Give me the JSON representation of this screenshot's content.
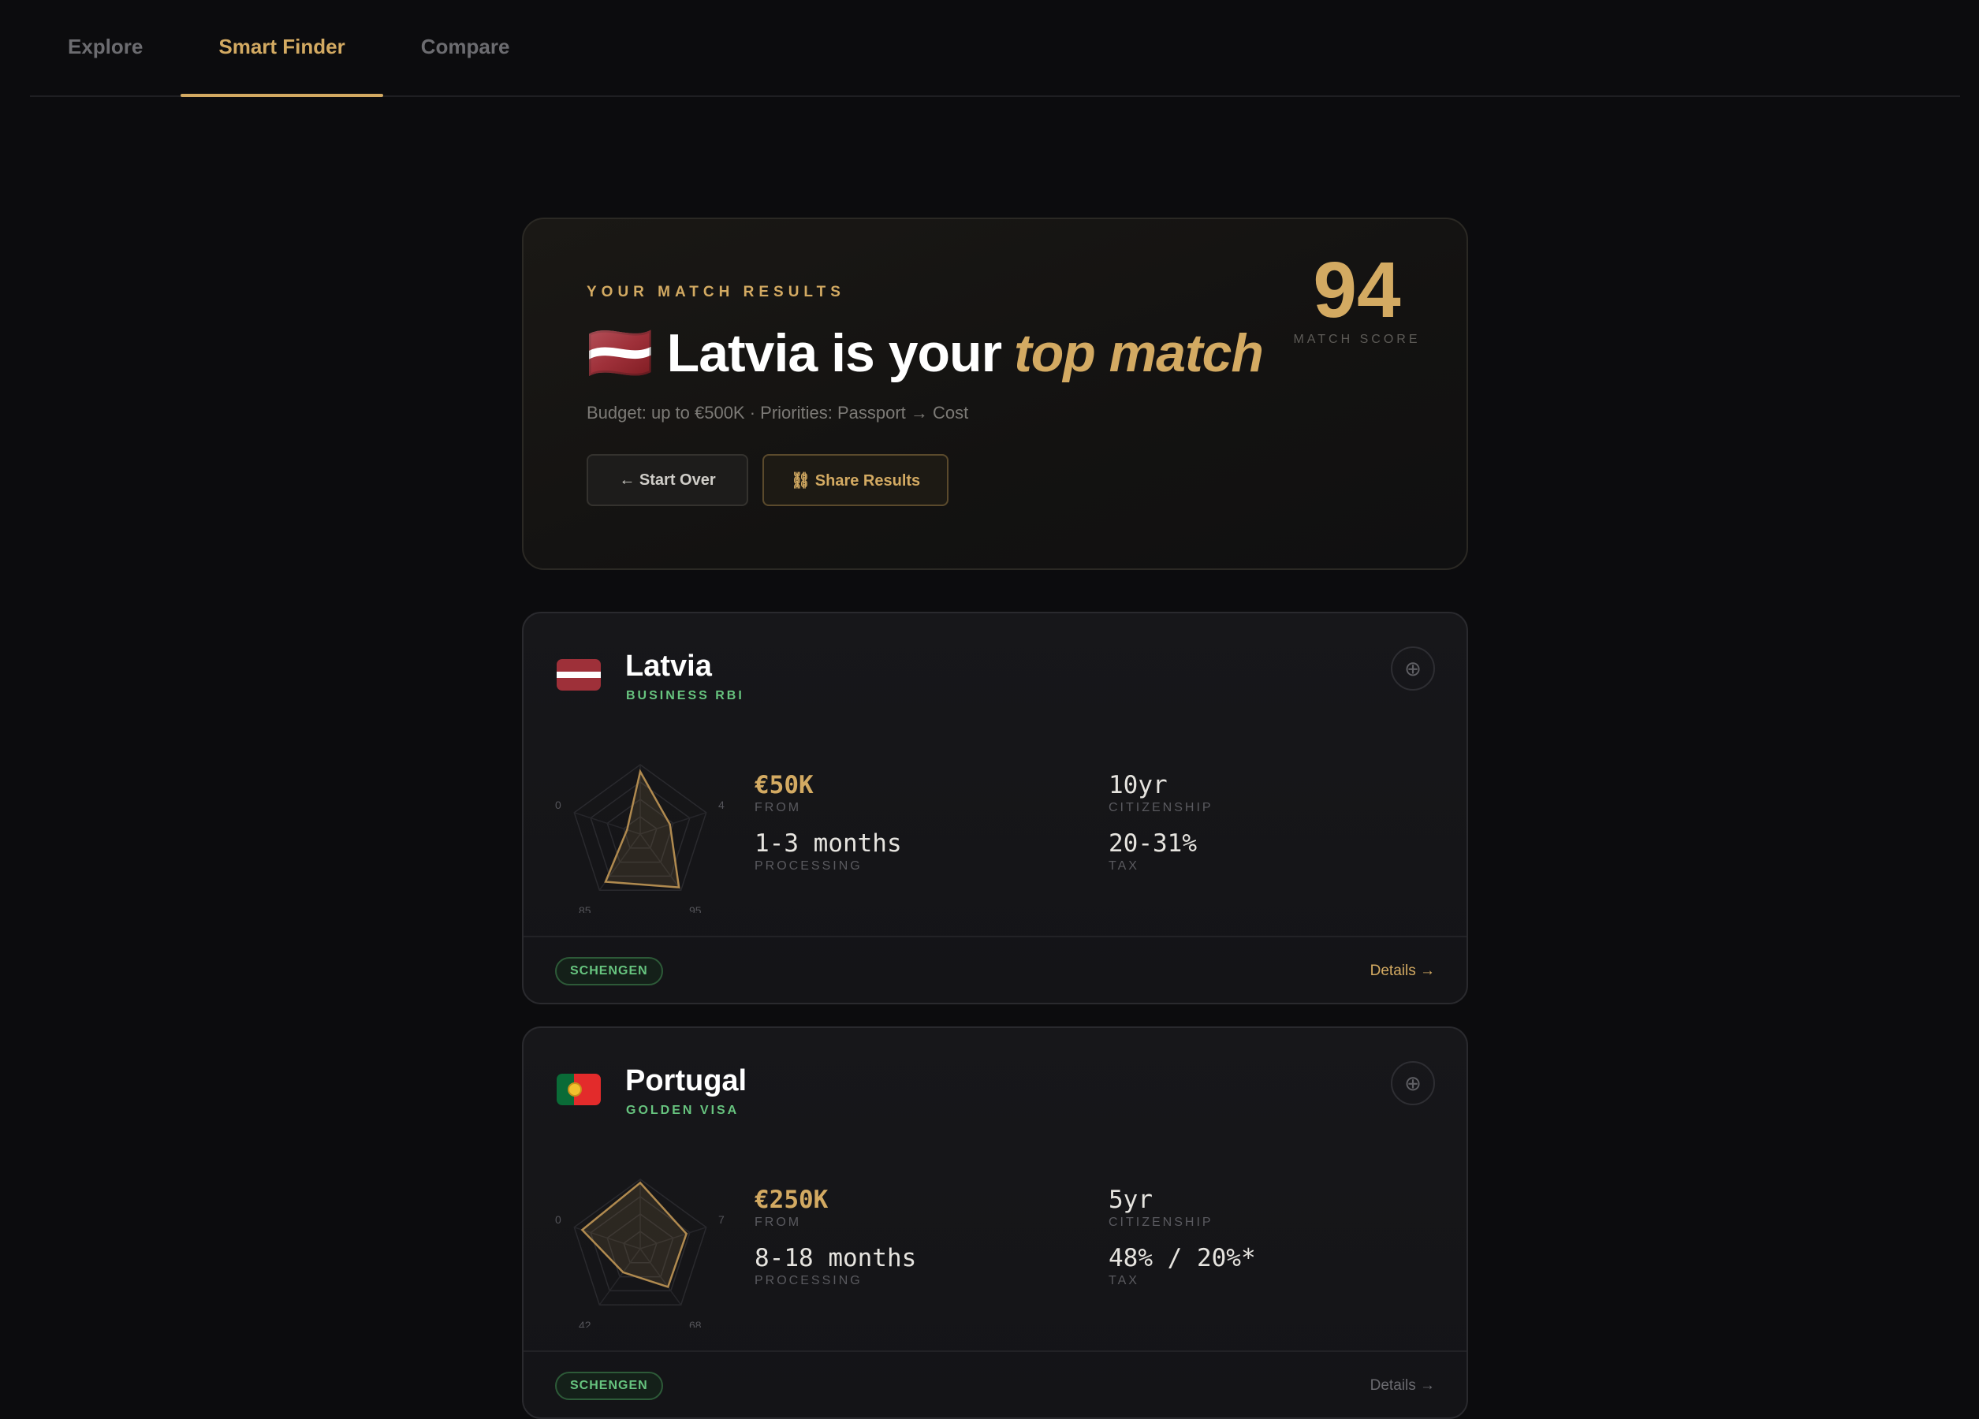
{
  "tabs": [
    {
      "label": "Explore",
      "active": false
    },
    {
      "label": "Smart Finder",
      "active": true
    },
    {
      "label": "Compare",
      "active": false
    }
  ],
  "hero": {
    "eyebrow": "YOUR MATCH RESULTS",
    "flag": "🇱🇻",
    "title_prefix": "Latvia is your",
    "title_accent": "top match",
    "criteria": "Budget: up to €500K · Priorities: Passport → Cost",
    "start_over_label": "← Start Over",
    "share_label": "⛓ Share Results",
    "score": "94",
    "score_label": "MATCH SCORE"
  },
  "results": [
    {
      "name": "Latvia",
      "program": "BUSINESS RBI",
      "flag_colors": [
        "#9e3039",
        "#ffffff",
        "#9e3039"
      ],
      "price": "€50K",
      "price_label": "FROM",
      "processing": "1-3 months",
      "processing_label": "PROCESSING",
      "citizenship": "10yr",
      "citizenship_label": "CITIZENSHIP",
      "tax": "20-31%",
      "tax_label": "TAX",
      "radar_scores": [
        90,
        45,
        95,
        85,
        20
      ],
      "radar_labels": [
        "0",
        "4",
        "95",
        "85"
      ],
      "badge": "SCHENGEN",
      "details_label": "Details →"
    },
    {
      "name": "Portugal",
      "program": "GOLDEN VISA",
      "flag_colors": [
        "#0a6b37",
        "#e32b2b",
        "#f2c12e"
      ],
      "price": "€250K",
      "price_label": "FROM",
      "processing": "8-18 months",
      "processing_label": "PROCESSING",
      "citizenship": "5yr",
      "citizenship_label": "CITIZENSHIP",
      "tax": "48% / 20%*",
      "tax_label": "TAX",
      "radar_scores": [
        95,
        70,
        68,
        42,
        88
      ],
      "radar_labels": [
        "0",
        "7",
        "68",
        "42"
      ],
      "badge": "SCHENGEN",
      "details_label": "Details →"
    }
  ]
}
